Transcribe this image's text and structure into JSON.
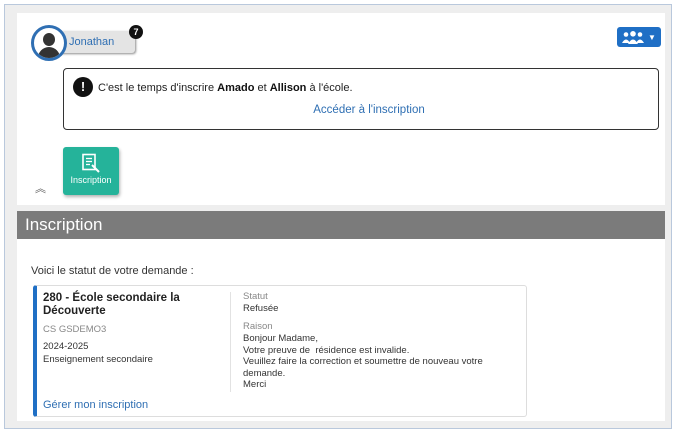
{
  "user": {
    "name": "Jonathan",
    "notification_count": "7"
  },
  "header": {
    "family_icon": "family-group-icon",
    "dropdown_icon": "caret-down-icon"
  },
  "notice": {
    "text_before": "C'est le temps d'inscrire ",
    "child1": "Amado",
    "text_mid": " et ",
    "child2": "Allison",
    "text_after": " à l'école.",
    "link": "Accéder à l'inscription"
  },
  "tile": {
    "label": "Inscription",
    "icon": "registration-form-icon"
  },
  "section": {
    "title": "Inscription",
    "intro": "Voici le statut de votre demande :"
  },
  "request": {
    "school": "280 - École secondaire la Découverte",
    "code": "CS GSDEMO3",
    "year": "2024-2025",
    "level": "Enseignement secondaire",
    "manage_link": "Gérer mon inscription",
    "status_label": "Statut",
    "status_value": "Refusée",
    "reason_label": "Raison",
    "reason_lines": [
      "Bonjour Madame,",
      "Votre preuve de  résidence est invalide.",
      "Veuillez faire la correction et soumettre de nouveau votre",
      "demande.",
      "Merci"
    ]
  },
  "colors": {
    "primary": "#1f6fc5",
    "tile": "#25b39a",
    "header_bar": "#7b7b7b",
    "link": "#2f6fb3"
  }
}
